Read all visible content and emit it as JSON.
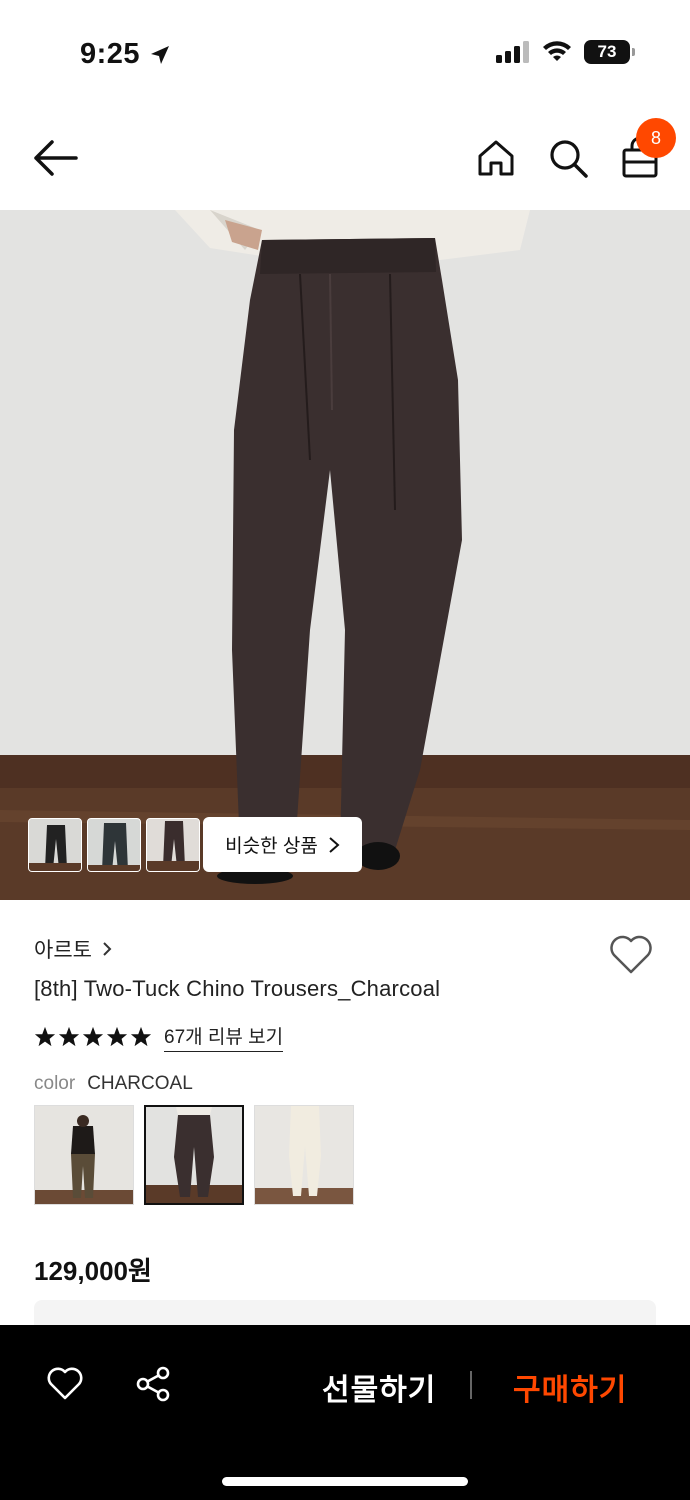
{
  "status": {
    "time": "9:25",
    "battery": "73"
  },
  "nav": {
    "cart_count": "8"
  },
  "hero": {
    "similar_label": "비슷한 상품"
  },
  "product": {
    "brand": "아르토",
    "title": "[8th] Two-Tuck Chino Trousers_Charcoal",
    "rating_stars": 5,
    "review_link": "67개 리뷰 보기",
    "color_label": "color",
    "color_value": "CHARCOAL",
    "swatches": [
      "brown",
      "charcoal",
      "ivory"
    ],
    "selected_swatch": "charcoal",
    "price": "129,000원"
  },
  "bottom_bar": {
    "gift_label": "선물하기",
    "buy_label": "구매하기"
  },
  "colors": {
    "accent": "#ff4800",
    "bottom_bar_bg": "#000000"
  },
  "icons": [
    "location-arrow-icon",
    "signal-icon",
    "wifi-icon",
    "battery-icon",
    "back-arrow-icon",
    "home-icon",
    "search-icon",
    "cart-icon",
    "chevron-right-icon",
    "heart-icon",
    "star-icon",
    "share-icon"
  ]
}
